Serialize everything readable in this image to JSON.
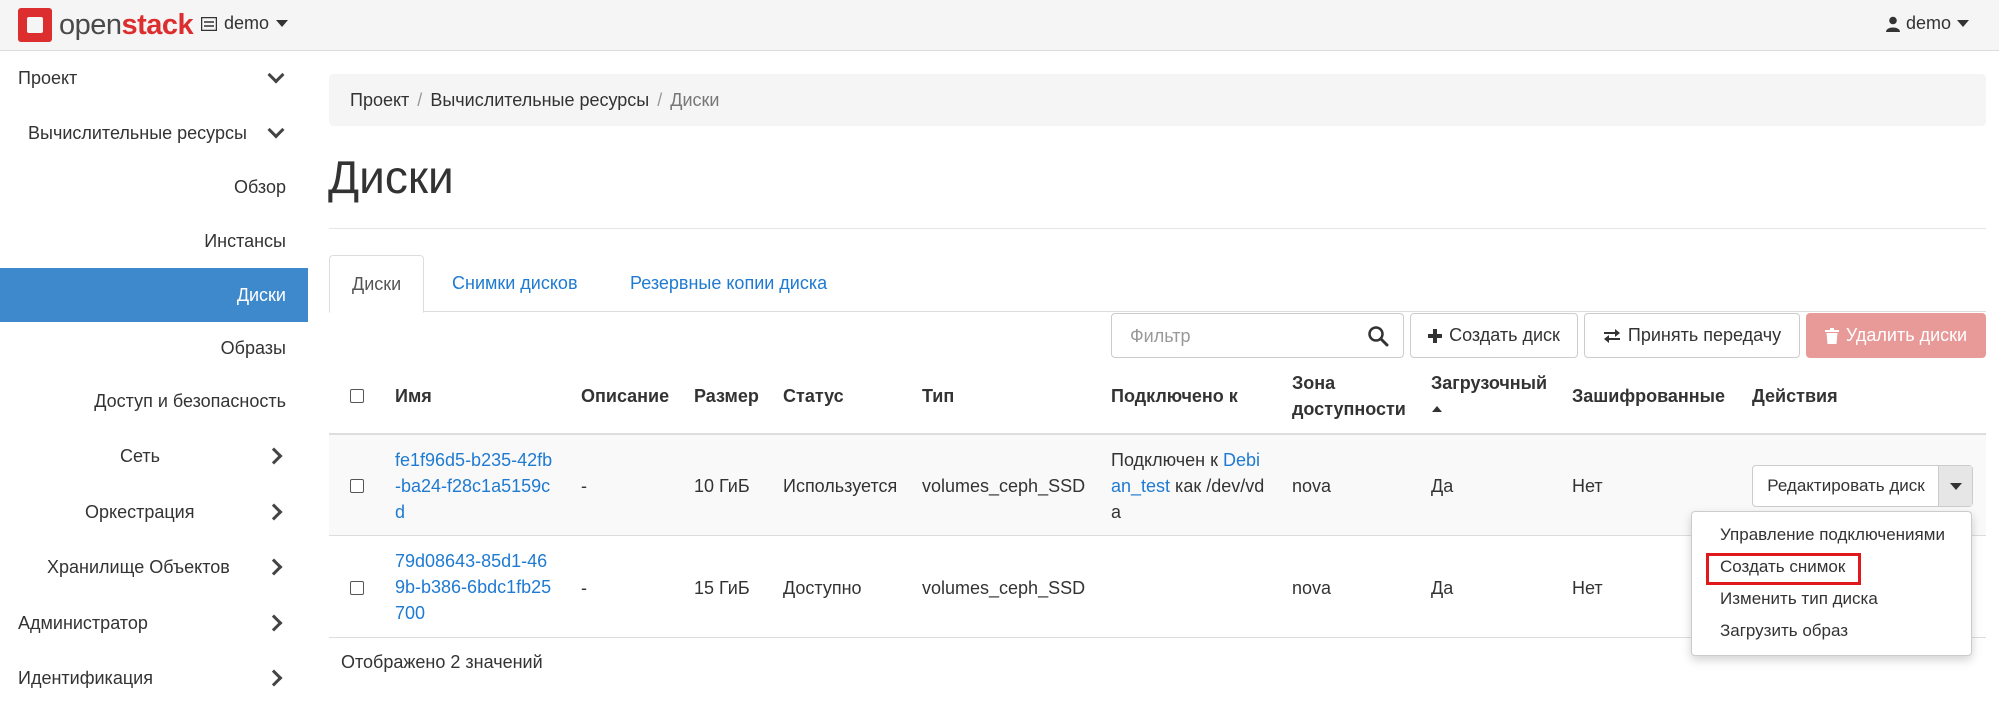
{
  "topbar": {
    "logo_prefix": "open",
    "logo_suffix": "stack",
    "project_selector": "demo",
    "user_menu": "demo"
  },
  "sidebar": {
    "items": [
      {
        "label": "Проект",
        "icon": "chevron-down-icon"
      },
      {
        "label": "Вычислительные ресурсы",
        "icon": "chevron-down-icon"
      },
      {
        "label": "Обзор"
      },
      {
        "label": "Инстансы"
      },
      {
        "label": "Диски",
        "active": true
      },
      {
        "label": "Образы"
      },
      {
        "label": "Доступ и безопасность"
      },
      {
        "label": "Сеть",
        "icon": "chevron-right-icon"
      },
      {
        "label": "Оркестрация",
        "icon": "chevron-right-icon"
      },
      {
        "label": "Хранилище Объектов",
        "icon": "chevron-right-icon"
      },
      {
        "label": "Администратор",
        "icon": "chevron-right-icon"
      },
      {
        "label": "Идентификация",
        "icon": "chevron-right-icon"
      }
    ]
  },
  "breadcrumb": [
    "Проект",
    "Вычислительные ресурсы",
    "Диски"
  ],
  "page_title": "Диски",
  "tabs": [
    "Диски",
    "Снимки дисков",
    "Резервные копии диска"
  ],
  "actions": {
    "filter_placeholder": "Фильтр",
    "create": "Создать диск",
    "accept_transfer": "Принять передачу",
    "delete": "Удалить диски"
  },
  "table": {
    "headers": {
      "name": "Имя",
      "description": "Описание",
      "size": "Размер",
      "status": "Статус",
      "type": "Тип",
      "attached": "Подключено к",
      "zone_l1": "Зона",
      "zone_l2": "доступности",
      "bootable": "Загрузочный",
      "encrypted": "Зашифрованные",
      "actions": "Действия"
    },
    "rows": [
      {
        "name_lines": [
          "fe1f96d5-b235-42fb",
          "-ba24-f28c1a5159c",
          "d"
        ],
        "description": "-",
        "size": "10 ГиБ",
        "status": "Используется",
        "type": "volumes_ceph_SSD",
        "attached_prefix": "Подключен к ",
        "attached_link_1": "Debi",
        "attached_link_2": "an_test",
        "attached_suffix_1": " как /dev/vd",
        "attached_suffix_2": "a",
        "zone": "nova",
        "bootable": "Да",
        "encrypted": "Нет",
        "action": "Редактировать диск"
      },
      {
        "name_lines": [
          "79d08643-85d1-46",
          "9b-b386-6bdc1fb25",
          "700"
        ],
        "description": "-",
        "size": "15 ГиБ",
        "status": "Доступно",
        "type": "volumes_ceph_SSD",
        "zone": "nova",
        "bootable": "Да",
        "encrypted": "Нет"
      }
    ]
  },
  "dropdown_menu": [
    "Управление подключениями",
    "Создать снимок",
    "Изменить тип диска",
    "Загрузить образ"
  ],
  "footer": "Отображено 2 значений",
  "colors": {
    "accent": "#3e88cc",
    "link": "#1f7ad1",
    "danger": "#e89a98",
    "highlight": "#e0181b",
    "logo": "#dc2e2e"
  }
}
